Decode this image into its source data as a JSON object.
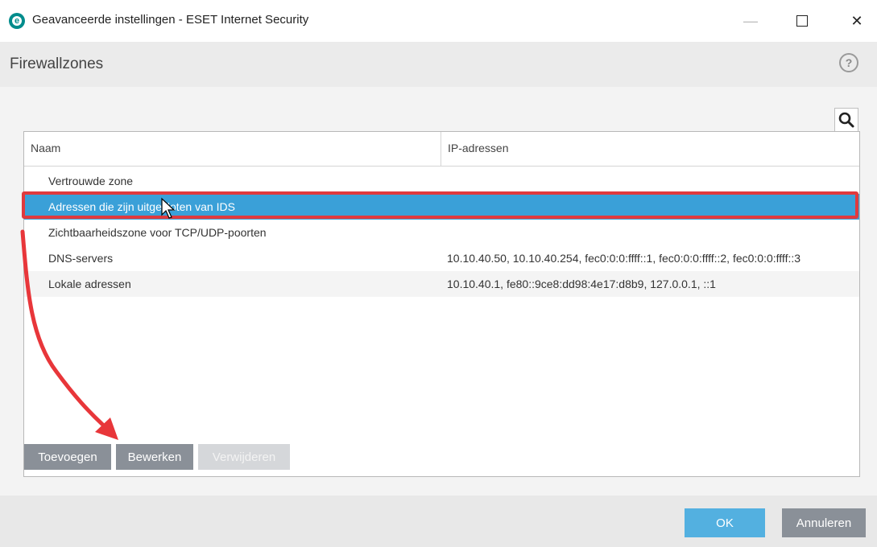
{
  "window": {
    "title": "Geavanceerde instellingen - ESET Internet Security",
    "min_glyph": "—",
    "close_glyph": "✕"
  },
  "header": {
    "title": "Firewallzones",
    "help_glyph": "?"
  },
  "table": {
    "columns": [
      "Naam",
      "IP-adressen"
    ],
    "rows": [
      {
        "name": "Vertrouwde zone",
        "ips": ""
      },
      {
        "name": "Adressen die zijn uitgesloten van IDS",
        "ips": "",
        "selected": true
      },
      {
        "name": "Zichtbaarheidszone voor TCP/UDP-poorten",
        "ips": ""
      },
      {
        "name": "DNS-servers",
        "ips": "10.10.40.50, 10.10.40.254, fec0:0:0:ffff::1, fec0:0:0:ffff::2, fec0:0:0:ffff::3"
      },
      {
        "name": "Lokale adressen",
        "ips": "10.10.40.1, fe80::9ce8:dd98:4e17:d8b9, 127.0.0.1, ::1"
      }
    ]
  },
  "actions": {
    "add": "Toevoegen",
    "edit": "Bewerken",
    "remove": "Verwijderen"
  },
  "footer": {
    "ok": "OK",
    "cancel": "Annuleren"
  },
  "colors": {
    "accent": "#3aa0d8",
    "highlight": "#e03a3e",
    "button": "#8a9098"
  },
  "icons": {
    "logo": "eset-logo-icon",
    "search": "search-icon",
    "help": "help-icon",
    "cursor": "mouse-cursor-icon",
    "arrow": "annotation-arrow"
  }
}
